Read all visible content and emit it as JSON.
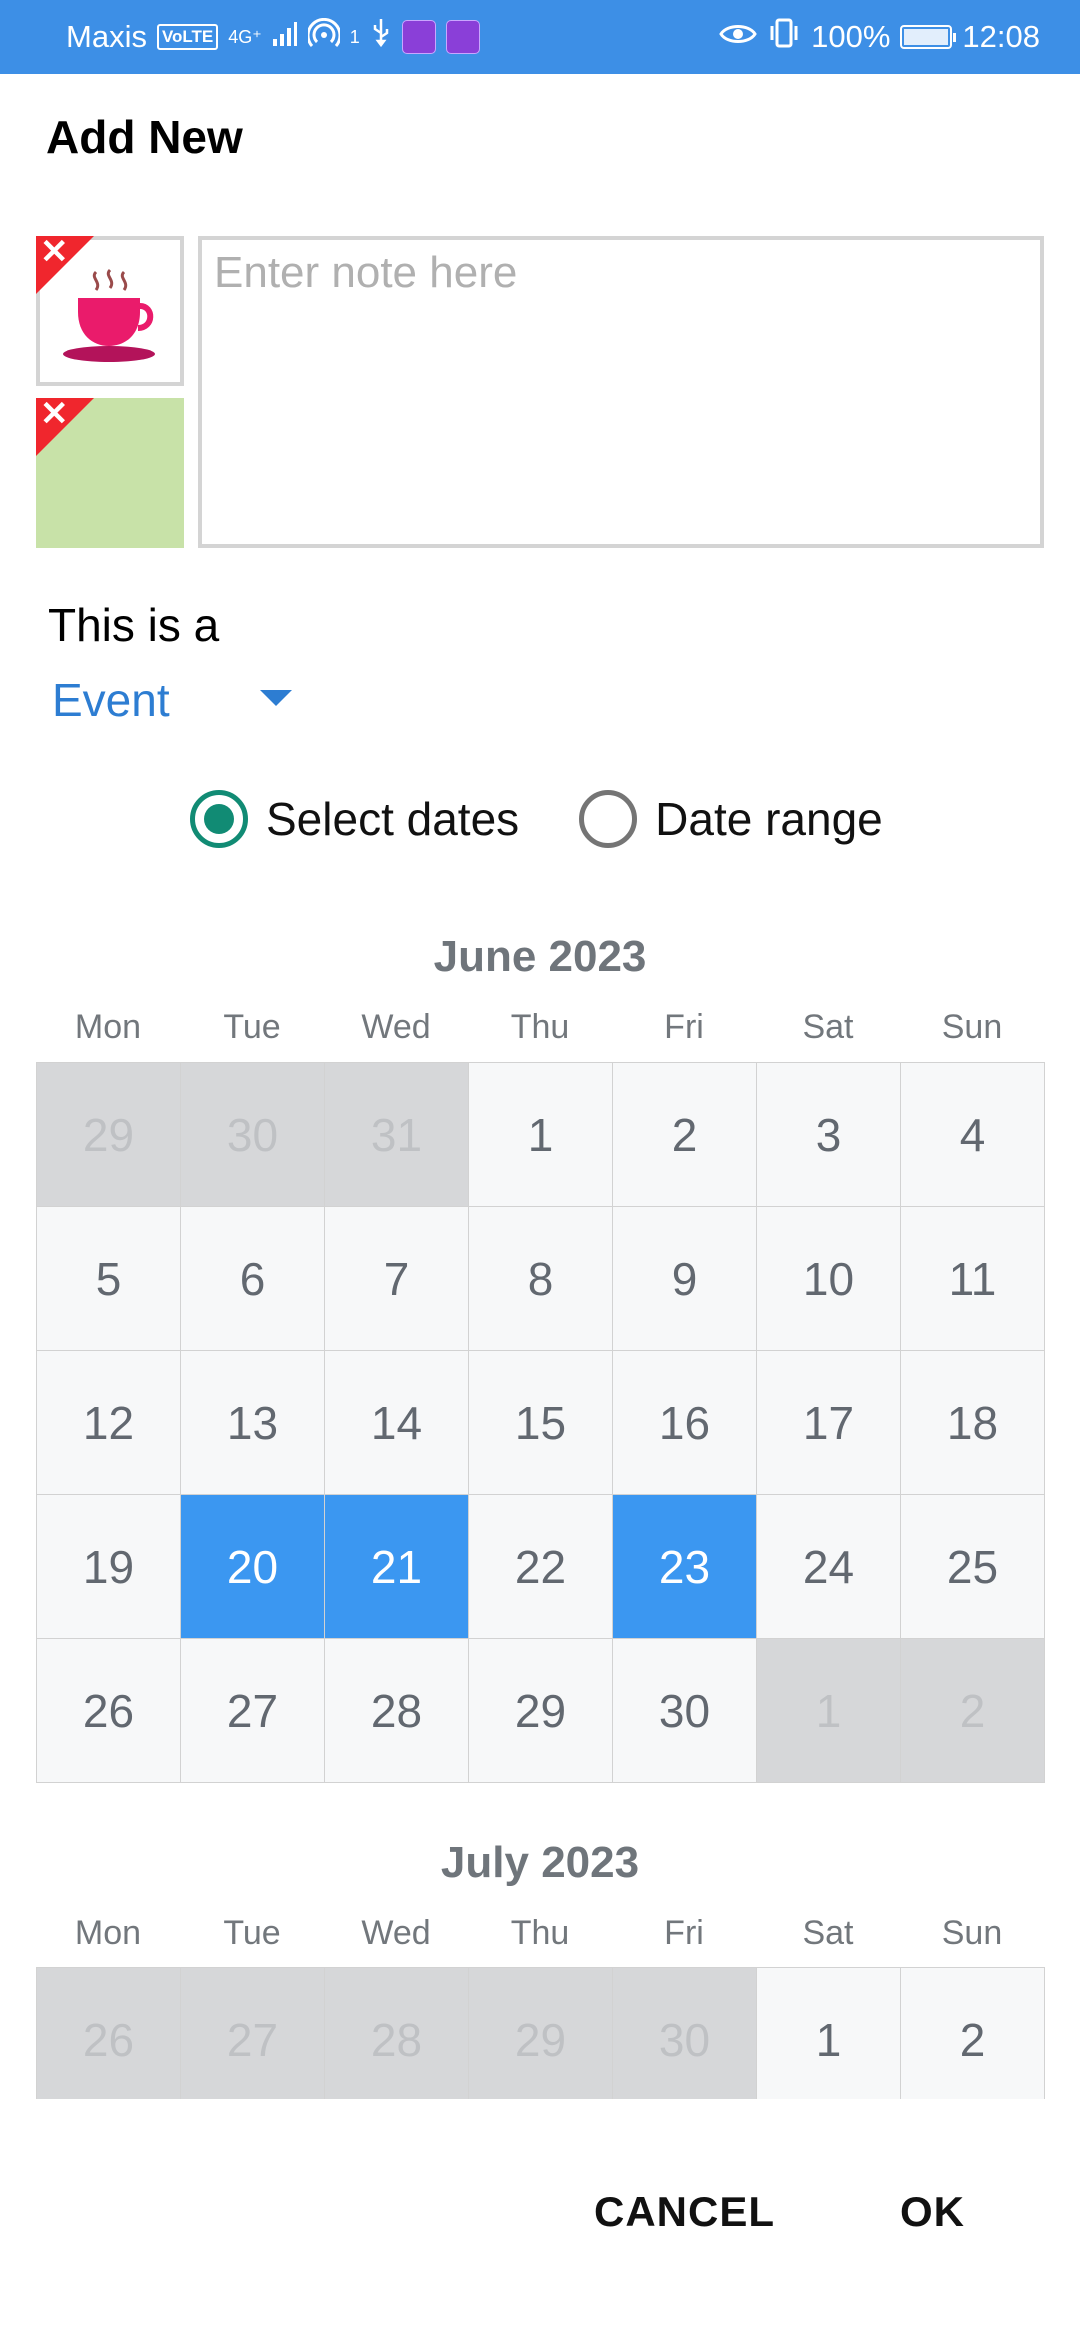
{
  "status_bar": {
    "carrier": "Maxis",
    "volte": "VoLTE",
    "network": "4G⁺",
    "hotspot_count": "1",
    "battery": "100%",
    "time": "12:08"
  },
  "dialog": {
    "title": "Add New",
    "note_placeholder": "Enter note here",
    "type_label": "This is a",
    "type_value": "Event",
    "radio_select_dates": "Select dates",
    "radio_date_range": "Date range",
    "cancel_label": "CANCEL",
    "ok_label": "OK"
  },
  "calendar": {
    "weekdays": [
      "Mon",
      "Tue",
      "Wed",
      "Thu",
      "Fri",
      "Sat",
      "Sun"
    ],
    "months": [
      {
        "title": "June 2023",
        "weeks": [
          [
            {
              "d": "29",
              "o": true
            },
            {
              "d": "30",
              "o": true
            },
            {
              "d": "31",
              "o": true
            },
            {
              "d": "1"
            },
            {
              "d": "2"
            },
            {
              "d": "3"
            },
            {
              "d": "4"
            }
          ],
          [
            {
              "d": "5"
            },
            {
              "d": "6"
            },
            {
              "d": "7"
            },
            {
              "d": "8"
            },
            {
              "d": "9"
            },
            {
              "d": "10"
            },
            {
              "d": "11"
            }
          ],
          [
            {
              "d": "12"
            },
            {
              "d": "13"
            },
            {
              "d": "14"
            },
            {
              "d": "15"
            },
            {
              "d": "16"
            },
            {
              "d": "17"
            },
            {
              "d": "18"
            }
          ],
          [
            {
              "d": "19"
            },
            {
              "d": "20",
              "s": true
            },
            {
              "d": "21",
              "s": true
            },
            {
              "d": "22"
            },
            {
              "d": "23",
              "s": true
            },
            {
              "d": "24"
            },
            {
              "d": "25"
            }
          ],
          [
            {
              "d": "26"
            },
            {
              "d": "27"
            },
            {
              "d": "28"
            },
            {
              "d": "29"
            },
            {
              "d": "30"
            },
            {
              "d": "1",
              "o": true
            },
            {
              "d": "2",
              "o": true
            }
          ]
        ]
      },
      {
        "title": "July 2023",
        "weeks": [
          [
            {
              "d": "26",
              "o": true
            },
            {
              "d": "27",
              "o": true
            },
            {
              "d": "28",
              "o": true
            },
            {
              "d": "29",
              "o": true
            },
            {
              "d": "30",
              "o": true
            },
            {
              "d": "1"
            },
            {
              "d": "2"
            }
          ]
        ]
      }
    ]
  },
  "colors": {
    "status_bar": "#3d8fe6",
    "selected_day": "#3b97f1",
    "radio_active": "#118b74",
    "link_blue": "#2d7dd2",
    "delete_badge": "#f0262d"
  },
  "icons": [
    "eye-icon",
    "vibrate-icon",
    "battery-icon",
    "usb-icon",
    "hotspot-icon",
    "signal-icon",
    "coffee-cup-icon",
    "delete-x-icon",
    "dropdown-caret-icon"
  ]
}
